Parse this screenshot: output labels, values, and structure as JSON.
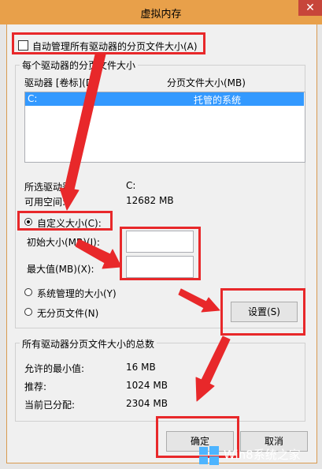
{
  "window": {
    "title": "虚拟内存",
    "close_label": "✕"
  },
  "auto_manage_label": "自动管理所有驱动器的分页文件大小(A)",
  "per_drive_group_label": "每个驱动器的分页文件大小",
  "drive_list": {
    "col_drive": "驱动器 [卷标](D)",
    "col_pagefile": "分页文件大小(MB)",
    "rows": [
      {
        "drive": "C:",
        "size": "托管的系统"
      }
    ]
  },
  "selected_drive_label": "所选驱动器:",
  "selected_drive_value": "C:",
  "free_space_label": "可用空间:",
  "free_space_value": "12682 MB",
  "custom_size_label": "自定义大小(C):",
  "initial_size_label": "初始大小(MB)(I):",
  "max_size_label": "最大值(MB)(X):",
  "system_managed_label": "系统管理的大小(Y)",
  "no_paging_label": "无分页文件(N)",
  "set_button_label": "设置(S)",
  "total_group_label": "所有驱动器分页文件大小的总数",
  "min_allowed_label": "允许的最小值:",
  "min_allowed_value": "16 MB",
  "recommended_label": "推荐:",
  "recommended_value": "1024 MB",
  "current_label": "当前已分配:",
  "current_value": "2304 MB",
  "ok_button_label": "确定",
  "cancel_button_label": "取消",
  "watermark_text": "Win8系统之家",
  "colors": {
    "highlight": "#e8282a",
    "selection": "#3399ff",
    "titlebar": "#e8a04a",
    "close": "#c7453a"
  }
}
